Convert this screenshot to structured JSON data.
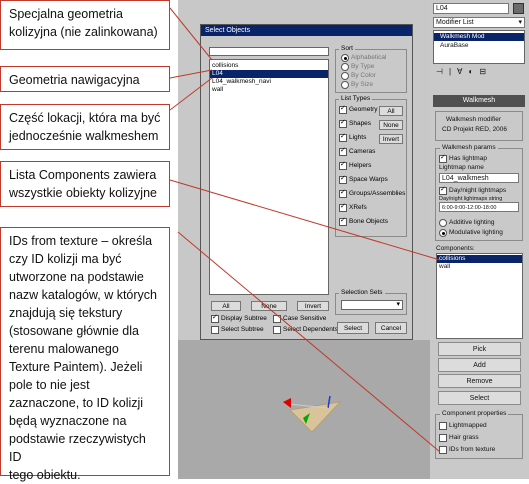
{
  "annotations": [
    {
      "id": "note-1",
      "lines": [
        "Specjalna geometria",
        "kolizyjna (nie zalinkowana)"
      ]
    },
    {
      "id": "note-2",
      "lines": [
        "Geometria nawigacyjna"
      ]
    },
    {
      "id": "note-3",
      "lines": [
        "Część lokacji, która ma być",
        "jednocześnie walkmeshem"
      ]
    },
    {
      "id": "note-4",
      "lines": [
        "Lista Components zawiera",
        "wszystkie obiekty kolizyjne"
      ]
    },
    {
      "id": "note-5",
      "lines": [
        "IDs from texture – określa",
        "czy ID kolizji ma być",
        "utworzone na podstawie",
        "nazw katalogów, w których",
        "znajdują się tekstury",
        "(stosowane głównie dla",
        "terenu malowanego",
        "Texture Paintem). Jeżeli",
        "pole to nie jest",
        "zaznaczone, to ID kolizji",
        "będą wyznaczone na",
        "podstawie rzeczywistych ID",
        "tego obiektu."
      ]
    }
  ],
  "dialog": {
    "title": "Select Objects",
    "list_items": [
      "collisions",
      "L04",
      "L04_walkmesh_navi",
      "wall"
    ],
    "selected_item": "L04",
    "sort": {
      "title": "Sort",
      "options": [
        "Alphabetical",
        "By Type",
        "By Color",
        "By Size"
      ],
      "selected": "Alphabetical"
    },
    "list_types": {
      "title": "List Types",
      "items": [
        "Geometry",
        "Shapes",
        "Lights",
        "Cameras",
        "Helpers",
        "Space Warps",
        "Groups/Assemblies",
        "XRefs",
        "Bone Objects"
      ],
      "buttons": [
        "All",
        "None",
        "Invert"
      ]
    },
    "bottom_buttons": [
      "All",
      "None",
      "Invert"
    ],
    "checks": [
      "Display Subtree",
      "Case Sensitive",
      "Select Subtree",
      "Select Dependents"
    ],
    "selection_sets_title": "Selection Sets",
    "select_label": "Select",
    "cancel_label": "Cancel"
  },
  "right_panel": {
    "name_field": "L04",
    "modifier_list": "Modifier List",
    "stack": [
      "Walkmesh Mod",
      "AuraBase"
    ],
    "header": "Walkmesh",
    "info": [
      "Walkmesh modifier",
      "CD Projekt RED, 2006"
    ],
    "params_title": "Walkmesh params",
    "has_lightmap": "Has lightmap",
    "lightmap_name_label": "Lightmap name",
    "lightmap_name": "L04_walkmesh",
    "day_night": "Day/night lightmaps",
    "day_night_hours": "Day/night lightmaps string",
    "hours_value": "6:00-9:00-12:00-18:00",
    "additive": "Additive lighting",
    "modulative": "Modulative lighting",
    "components_label": "Components:",
    "components": [
      "collisions",
      "wall"
    ],
    "buttons": [
      "Pick",
      "Add",
      "Remove",
      "Select"
    ],
    "comp_props_title": "Component properties",
    "comp_props": [
      "Lightmapped",
      "Hair grass",
      "IDs from texture"
    ]
  },
  "colors": {
    "annotation_border": "#c0392b",
    "selection": "#0a246a"
  }
}
